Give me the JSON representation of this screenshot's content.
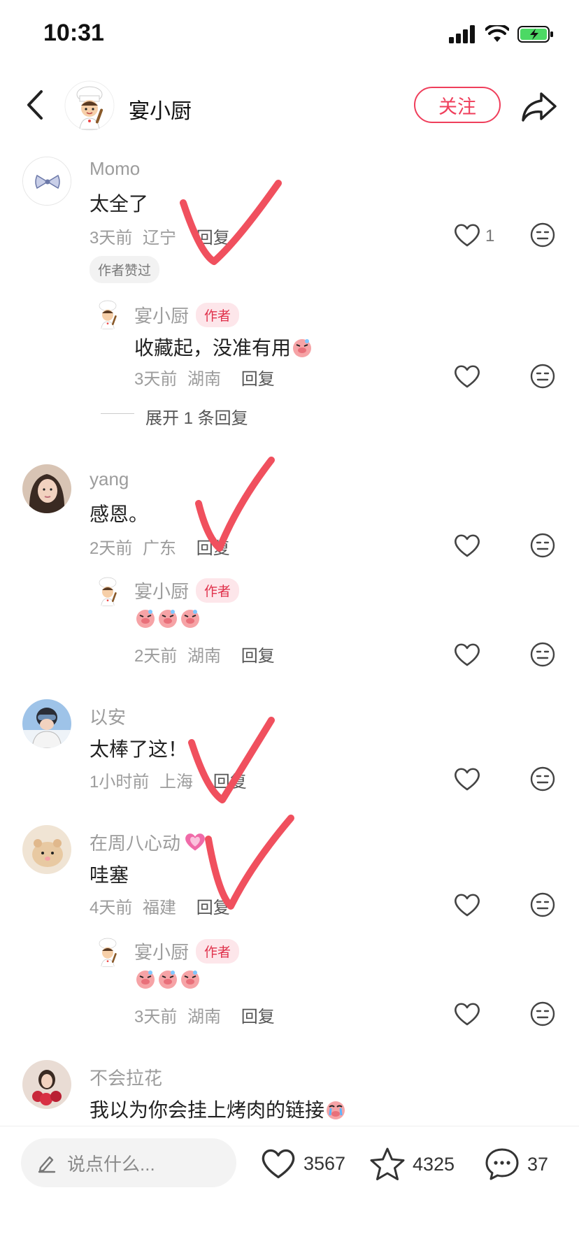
{
  "status_bar": {
    "time": "10:31"
  },
  "header": {
    "title": "宴小厨",
    "follow_label": "关注"
  },
  "comments": [
    {
      "user": "Momo",
      "text": "太全了",
      "time": "3天前",
      "location": "辽宁",
      "reply_label": "回复",
      "like_count": "1",
      "liked_tag": "作者赞过",
      "replies": [
        {
          "user": "宴小厨",
          "tag": "作者",
          "text": "收藏起，没准有用",
          "time": "3天前",
          "location": "湖南",
          "reply_label": "回复"
        }
      ],
      "expand_label": "展开 1 条回复"
    },
    {
      "user": "yang",
      "text": "感恩。",
      "time": "2天前",
      "location": "广东",
      "reply_label": "回复",
      "replies": [
        {
          "user": "宴小厨",
          "tag": "作者",
          "text": "",
          "time": "2天前",
          "location": "湖南",
          "reply_label": "回复"
        }
      ]
    },
    {
      "user": "以安",
      "text": "太棒了这！",
      "time": "1小时前",
      "location": "上海",
      "reply_label": "回复"
    },
    {
      "user": "在周八心动",
      "text": "哇塞",
      "time": "4天前",
      "location": "福建",
      "reply_label": "回复",
      "replies": [
        {
          "user": "宴小厨",
          "tag": "作者",
          "text": "",
          "time": "3天前",
          "location": "湖南",
          "reply_label": "回复"
        }
      ]
    },
    {
      "user": "不会拉花",
      "text": "我以为你会挂上烤肉的链接"
    }
  ],
  "bottom_bar": {
    "input_placeholder": "说点什么...",
    "likes": "3567",
    "favorites": "4325",
    "comments": "37"
  },
  "colors": {
    "accent": "#ef3e5b",
    "check_mark": "#f0505e"
  }
}
